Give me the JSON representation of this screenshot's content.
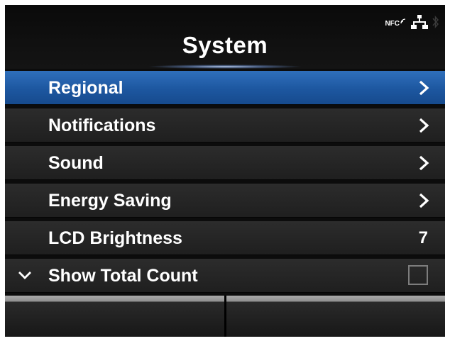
{
  "header": {
    "title": "System",
    "status_icons": [
      "nfc-icon",
      "network-icon",
      "bluetooth-icon"
    ],
    "nfc_label": "NFC"
  },
  "menu": {
    "items": [
      {
        "label": "Regional",
        "selected": true,
        "control": "chevron-right-icon"
      },
      {
        "label": "Notifications",
        "selected": false,
        "control": "chevron-right-icon"
      },
      {
        "label": "Sound",
        "selected": false,
        "control": "chevron-right-icon"
      },
      {
        "label": "Energy Saving",
        "selected": false,
        "control": "chevron-right-icon"
      },
      {
        "label": "LCD Brightness",
        "selected": false,
        "value": "7"
      },
      {
        "label": "Show Total Count",
        "selected": false,
        "control": "checkbox",
        "checked": false,
        "leading_icon": "chevron-down-icon"
      }
    ]
  },
  "softkeys": {
    "left": "",
    "right": ""
  },
  "colors": {
    "background": "#0c0c0c",
    "selected": "#1d57a0",
    "row": "#262626",
    "text": "#ffffff",
    "softkey_top": "#a9a9a9"
  }
}
